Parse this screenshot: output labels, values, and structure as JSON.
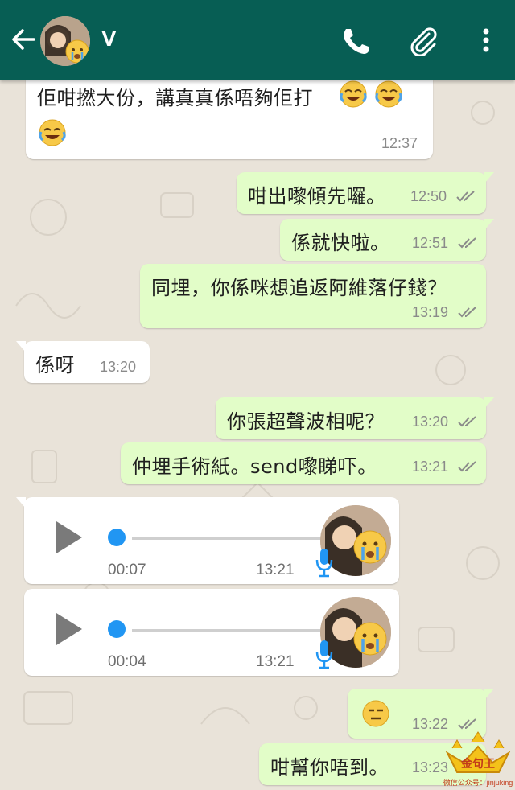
{
  "header": {
    "contact_name": "V",
    "back_icon": "arrow-left-icon",
    "call_icon": "phone-icon",
    "attach_icon": "paperclip-icon",
    "menu_icon": "more-vert-icon",
    "background_color": "#075e54"
  },
  "messages": [
    {
      "direction": "in",
      "text": "佢咁撚大份，講真真係唔夠佢打",
      "trailing_emoji": [
        "face-with-tears-of-joy",
        "face-with-tears-of-joy"
      ],
      "second_line_emoji": [
        "face-with-tears-of-joy"
      ],
      "time": "12:37"
    },
    {
      "direction": "out",
      "text": "咁出嚟傾先囉。",
      "time": "12:50",
      "status": "read"
    },
    {
      "direction": "out",
      "text": "係就快啦。",
      "time": "12:51",
      "status": "read"
    },
    {
      "direction": "out",
      "text": "同埋，你係咪想追返阿維落仔錢？",
      "time": "13:19",
      "status": "read"
    },
    {
      "direction": "in",
      "text": "係呀",
      "time": "13:20"
    },
    {
      "direction": "out",
      "text": "你張超聲波相呢？",
      "time": "13:20",
      "status": "read"
    },
    {
      "direction": "out",
      "text": "仲埋手術紙。send嚟睇吓。",
      "time": "13:21",
      "status": "read"
    },
    {
      "direction": "in",
      "type": "voice",
      "duration": "00:07",
      "time": "13:21"
    },
    {
      "direction": "in",
      "type": "voice",
      "duration": "00:04",
      "time": "13:21"
    },
    {
      "direction": "out",
      "type": "emoji",
      "emoji": "expressionless-face",
      "time": "13:22",
      "status": "read"
    },
    {
      "direction": "out",
      "text": "咁幫你唔到。",
      "time": "13:23",
      "status": "read"
    }
  ],
  "watermark": {
    "text": "金句王",
    "subtext": "微信公众号：jinjuking"
  },
  "colors": {
    "incoming_bubble": "#ffffff",
    "outgoing_bubble": "#e2fdc8",
    "wallpaper": "#e9e3d9",
    "voice_accent": "#2196f3"
  }
}
